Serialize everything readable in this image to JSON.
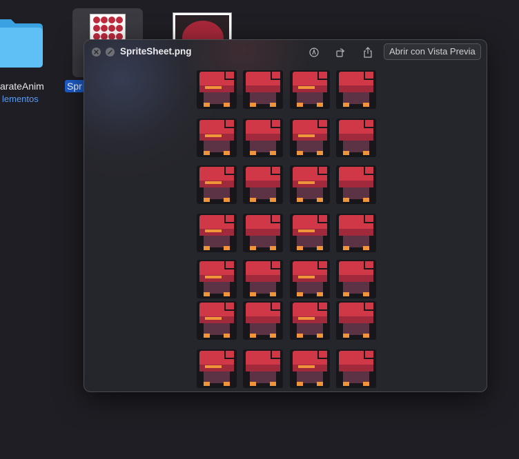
{
  "desktop": {
    "folder_name": "arateAnim",
    "folder_subtitle": "lementos",
    "selected_file_label": "Spr"
  },
  "quicklook": {
    "title": "SpriteSheet.png",
    "open_button": "Abrir con Vista Previa",
    "icons": {
      "close": "close-x-icon",
      "fullscreen": "fullscreen-icon",
      "markup": "markup-pen-icon",
      "rotate": "rotate-icon",
      "share": "share-icon"
    },
    "sprite_sheet": {
      "columns": 4,
      "rows": 7,
      "colors": {
        "head": "#d03848",
        "head_shade": "#a02a3c",
        "body": "#5b3345",
        "outline": "#17161a",
        "accent": "#f0953a"
      }
    }
  }
}
